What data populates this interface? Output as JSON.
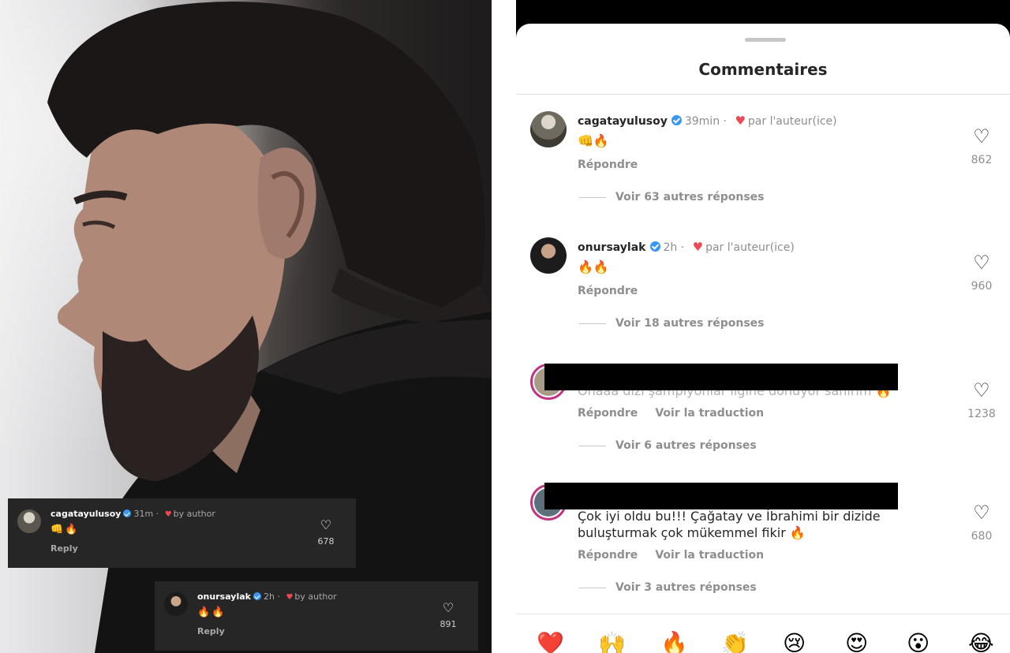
{
  "left_overlay": {
    "card1": {
      "username": "cagatayulusoy",
      "time": "31m",
      "by_author": "by author",
      "emojis": "👊🔥",
      "reply": "Reply",
      "likes": "678"
    },
    "card2": {
      "username": "onursaylak",
      "time": "2h",
      "by_author": "by author",
      "emojis": "🔥🔥",
      "reply": "Reply",
      "likes": "891"
    }
  },
  "sheet": {
    "title": "Commentaires",
    "comments": [
      {
        "username": "cagatayulusoy",
        "time": "39min",
        "by_author": "par l'auteur(ice)",
        "text": "👊🔥",
        "reply": "Répondre",
        "more": "Voir 63 autres réponses",
        "likes": "862"
      },
      {
        "username": "onursaylak",
        "time": "2h",
        "by_author": "par l'auteur(ice)",
        "text": "🔥🔥",
        "reply": "Répondre",
        "more": "Voir 18 autres réponses",
        "likes": "960"
      },
      {
        "text": "Ohaaa dizi şampiyonlar ligine dönüyor sanırım 🔥",
        "reply": "Répondre",
        "translate": "Voir la traduction",
        "more": "Voir 6 autres réponses",
        "likes": "1238"
      },
      {
        "text_line1": "Çok iyi oldu bu!!! Çağatay ve İbrahimi bir dizide",
        "text_line2": "buluşturmak çok mükemmel fikir 🔥",
        "reply": "Répondre",
        "translate": "Voir la traduction",
        "more": "Voir 3 autres réponses",
        "likes": "680"
      }
    ],
    "reactions": [
      "❤️",
      "🙌",
      "🔥",
      "👏",
      "😢",
      "😍",
      "😮",
      "😂"
    ]
  },
  "icons": {
    "heart": "♡",
    "heart_filled": "♥"
  },
  "colors": {
    "verified": "#3897f0",
    "heart_red": "#ed4956",
    "muted": "#8e8e8e"
  }
}
